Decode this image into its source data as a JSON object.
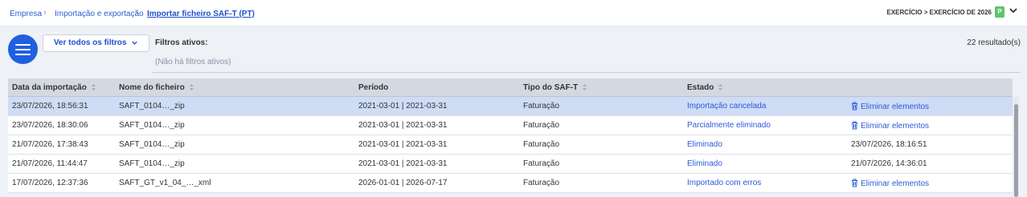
{
  "breadcrumb": {
    "items": [
      "Empresa",
      "Importação e exportação"
    ],
    "current": "Importar ficheiro SAF-T (PT)"
  },
  "exercise": {
    "label": "EXERCÍCIO > EXERCÍCIO DE 2026",
    "badge": "P"
  },
  "filters": {
    "button_label": "Ver todos os filtros",
    "active_label": "Filtros ativos:",
    "none_label": "(Não há filtros ativos)",
    "results": "22 resultado(s)"
  },
  "table": {
    "columns": [
      "Data da importação",
      "Nome do ficheiro",
      "Período",
      "Tipo do SAF-T",
      "Estado"
    ],
    "rows": [
      {
        "date": "23/07/2026, 18:56:31",
        "file": "SAFT_0104…_zip",
        "period": "2021-03-01 | 2021-03-31",
        "type": "Faturação",
        "status": "Importação cancelada",
        "action": "Eliminar elementos"
      },
      {
        "date": "23/07/2026, 18:30:06",
        "file": "SAFT_0104…_zip",
        "period": "2021-03-01 | 2021-03-31",
        "type": "Faturação",
        "status": "Parcialmente eliminado",
        "action": "Eliminar elementos"
      },
      {
        "date": "21/07/2026, 17:38:43",
        "file": "SAFT_0104…_zip",
        "period": "2021-03-01 | 2021-03-31",
        "type": "Faturação",
        "status": "Eliminado",
        "action": "23/07/2026, 18:16:51"
      },
      {
        "date": "21/07/2026, 11:44:47",
        "file": "SAFT_0104…_zip",
        "period": "2021-03-01 | 2021-03-31",
        "type": "Faturação",
        "status": "Eliminado",
        "action": "21/07/2026, 14:36:01"
      },
      {
        "date": "17/07/2026, 12:37:36",
        "file": "SAFT_GT_v1_04_…_xml",
        "period": "2026-01-01 | 2026-07-17",
        "type": "Faturação",
        "status": "Importado com erros",
        "action": "Eliminar elementos"
      }
    ]
  },
  "colors": {
    "accent": "#1f5fe0",
    "link": "#2a5bd7",
    "selected_row": "#cfdcf6",
    "header_bg": "#d4d9e1"
  }
}
